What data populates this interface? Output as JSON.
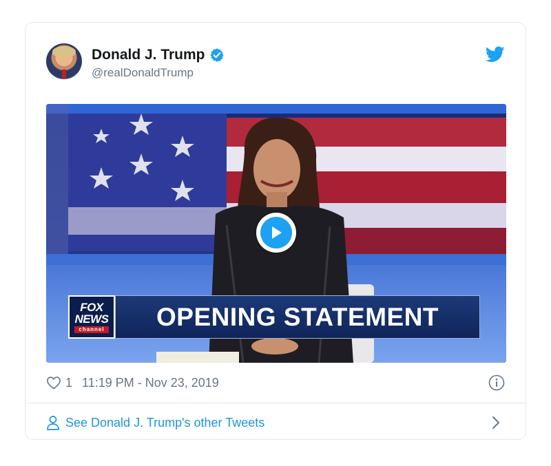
{
  "tweet": {
    "display_name": "Donald J. Trump",
    "handle": "@realDonaldTrump",
    "likes": "1",
    "timestamp": "11:19 PM - Nov 23, 2019",
    "other_tweets_link": "See Donald J. Trump's other Tweets"
  },
  "video": {
    "lower_third": "OPENING STATEMENT",
    "logo_line1": "FOX",
    "logo_line2": "NEWS",
    "logo_line3": "channel"
  },
  "icons": {
    "verified": "verified-badge-icon",
    "twitter": "twitter-bird-icon",
    "like": "heart-icon",
    "info": "info-icon",
    "person": "person-icon",
    "chevron": "chevron-right-icon",
    "play": "play-icon"
  },
  "colors": {
    "brand_blue": "#1da1f2",
    "link_blue": "#1b95e0",
    "muted_text": "#657786",
    "border": "#e1e8ed"
  }
}
